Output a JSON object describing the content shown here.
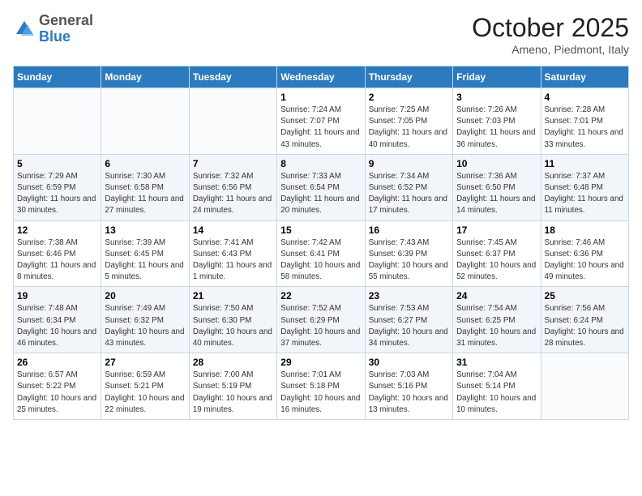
{
  "header": {
    "logo": {
      "general": "General",
      "blue": "Blue"
    },
    "title": "October 2025",
    "location": "Ameno, Piedmont, Italy"
  },
  "days_of_week": [
    "Sunday",
    "Monday",
    "Tuesday",
    "Wednesday",
    "Thursday",
    "Friday",
    "Saturday"
  ],
  "weeks": [
    [
      null,
      null,
      null,
      {
        "day": "1",
        "sunrise": "7:24 AM",
        "sunset": "7:07 PM",
        "daylight": "11 hours and 43 minutes."
      },
      {
        "day": "2",
        "sunrise": "7:25 AM",
        "sunset": "7:05 PM",
        "daylight": "11 hours and 40 minutes."
      },
      {
        "day": "3",
        "sunrise": "7:26 AM",
        "sunset": "7:03 PM",
        "daylight": "11 hours and 36 minutes."
      },
      {
        "day": "4",
        "sunrise": "7:28 AM",
        "sunset": "7:01 PM",
        "daylight": "11 hours and 33 minutes."
      }
    ],
    [
      {
        "day": "5",
        "sunrise": "7:29 AM",
        "sunset": "6:59 PM",
        "daylight": "11 hours and 30 minutes."
      },
      {
        "day": "6",
        "sunrise": "7:30 AM",
        "sunset": "6:58 PM",
        "daylight": "11 hours and 27 minutes."
      },
      {
        "day": "7",
        "sunrise": "7:32 AM",
        "sunset": "6:56 PM",
        "daylight": "11 hours and 24 minutes."
      },
      {
        "day": "8",
        "sunrise": "7:33 AM",
        "sunset": "6:54 PM",
        "daylight": "11 hours and 20 minutes."
      },
      {
        "day": "9",
        "sunrise": "7:34 AM",
        "sunset": "6:52 PM",
        "daylight": "11 hours and 17 minutes."
      },
      {
        "day": "10",
        "sunrise": "7:36 AM",
        "sunset": "6:50 PM",
        "daylight": "11 hours and 14 minutes."
      },
      {
        "day": "11",
        "sunrise": "7:37 AM",
        "sunset": "6:48 PM",
        "daylight": "11 hours and 11 minutes."
      }
    ],
    [
      {
        "day": "12",
        "sunrise": "7:38 AM",
        "sunset": "6:46 PM",
        "daylight": "11 hours and 8 minutes."
      },
      {
        "day": "13",
        "sunrise": "7:39 AM",
        "sunset": "6:45 PM",
        "daylight": "11 hours and 5 minutes."
      },
      {
        "day": "14",
        "sunrise": "7:41 AM",
        "sunset": "6:43 PM",
        "daylight": "11 hours and 1 minute."
      },
      {
        "day": "15",
        "sunrise": "7:42 AM",
        "sunset": "6:41 PM",
        "daylight": "10 hours and 58 minutes."
      },
      {
        "day": "16",
        "sunrise": "7:43 AM",
        "sunset": "6:39 PM",
        "daylight": "10 hours and 55 minutes."
      },
      {
        "day": "17",
        "sunrise": "7:45 AM",
        "sunset": "6:37 PM",
        "daylight": "10 hours and 52 minutes."
      },
      {
        "day": "18",
        "sunrise": "7:46 AM",
        "sunset": "6:36 PM",
        "daylight": "10 hours and 49 minutes."
      }
    ],
    [
      {
        "day": "19",
        "sunrise": "7:48 AM",
        "sunset": "6:34 PM",
        "daylight": "10 hours and 46 minutes."
      },
      {
        "day": "20",
        "sunrise": "7:49 AM",
        "sunset": "6:32 PM",
        "daylight": "10 hours and 43 minutes."
      },
      {
        "day": "21",
        "sunrise": "7:50 AM",
        "sunset": "6:30 PM",
        "daylight": "10 hours and 40 minutes."
      },
      {
        "day": "22",
        "sunrise": "7:52 AM",
        "sunset": "6:29 PM",
        "daylight": "10 hours and 37 minutes."
      },
      {
        "day": "23",
        "sunrise": "7:53 AM",
        "sunset": "6:27 PM",
        "daylight": "10 hours and 34 minutes."
      },
      {
        "day": "24",
        "sunrise": "7:54 AM",
        "sunset": "6:25 PM",
        "daylight": "10 hours and 31 minutes."
      },
      {
        "day": "25",
        "sunrise": "7:56 AM",
        "sunset": "6:24 PM",
        "daylight": "10 hours and 28 minutes."
      }
    ],
    [
      {
        "day": "26",
        "sunrise": "6:57 AM",
        "sunset": "5:22 PM",
        "daylight": "10 hours and 25 minutes."
      },
      {
        "day": "27",
        "sunrise": "6:59 AM",
        "sunset": "5:21 PM",
        "daylight": "10 hours and 22 minutes."
      },
      {
        "day": "28",
        "sunrise": "7:00 AM",
        "sunset": "5:19 PM",
        "daylight": "10 hours and 19 minutes."
      },
      {
        "day": "29",
        "sunrise": "7:01 AM",
        "sunset": "5:18 PM",
        "daylight": "10 hours and 16 minutes."
      },
      {
        "day": "30",
        "sunrise": "7:03 AM",
        "sunset": "5:16 PM",
        "daylight": "10 hours and 13 minutes."
      },
      {
        "day": "31",
        "sunrise": "7:04 AM",
        "sunset": "5:14 PM",
        "daylight": "10 hours and 10 minutes."
      },
      null
    ]
  ]
}
